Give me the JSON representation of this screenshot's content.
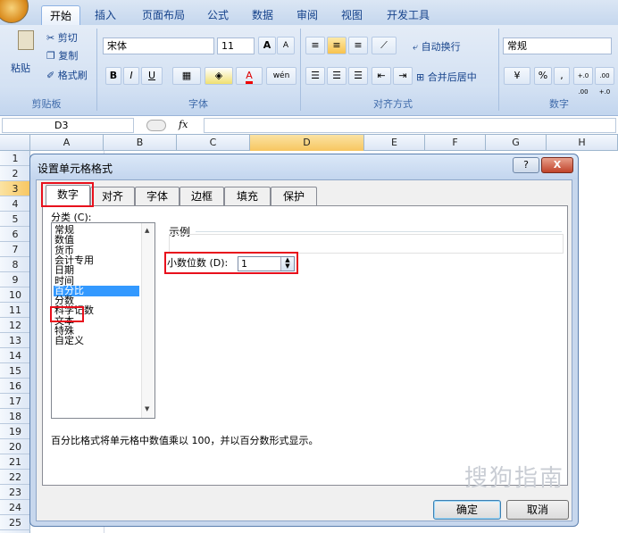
{
  "ribbon_tabs": [
    "开始",
    "插入",
    "页面布局",
    "公式",
    "数据",
    "审阅",
    "视图",
    "开发工具"
  ],
  "clipboard": {
    "paste": "粘贴",
    "cut": "剪切",
    "copy": "复制",
    "format_painter": "格式刷",
    "label": "剪贴板"
  },
  "font": {
    "name": "宋体",
    "size": "11",
    "bold": "B",
    "italic": "I",
    "underline": "U",
    "label": "字体",
    "wen": "wén",
    "grow": "A",
    "shrink": "A"
  },
  "alignment": {
    "wrap": "自动换行",
    "merge": "合并后居中",
    "label": "对齐方式"
  },
  "number": {
    "format": "常规",
    "label": "数字",
    "percent": "%",
    "comma": ",",
    "inc": "+.0 .00",
    "dec": ".00 +.0"
  },
  "name_box": "D3",
  "fx": "fx",
  "columns": [
    "A",
    "B",
    "C",
    "D",
    "E",
    "F",
    "G",
    "H"
  ],
  "rows": [
    "1",
    "2",
    "3",
    "4",
    "5",
    "6",
    "7",
    "8",
    "9",
    "10",
    "11",
    "12",
    "13",
    "14",
    "15",
    "16",
    "17",
    "18",
    "19",
    "20",
    "21",
    "22",
    "23",
    "24",
    "25"
  ],
  "dialog": {
    "title": "设置单元格格式",
    "help": "?",
    "close": "X",
    "tabs": [
      "数字",
      "对齐",
      "字体",
      "边框",
      "填充",
      "保护"
    ],
    "category_label": "分类 (C):",
    "categories": [
      "常规",
      "数值",
      "货币",
      "会计专用",
      "日期",
      "时间",
      "百分比",
      "分数",
      "科学记数",
      "文本",
      "特殊",
      "自定义"
    ],
    "selected_category": "百分比",
    "sample_label": "示例",
    "decimal_label": "小数位数 (D):",
    "decimal_value": "1",
    "description": "百分比格式将单元格中数值乘以 100，并以百分数形式显示。",
    "ok": "确定",
    "cancel": "取消"
  },
  "watermark": "搜狗指南"
}
